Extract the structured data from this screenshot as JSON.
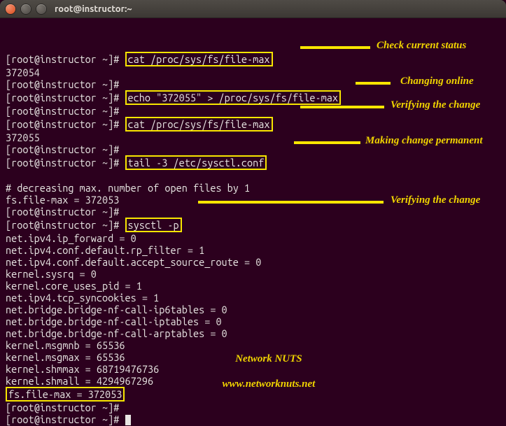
{
  "window": {
    "title": "root@instructor:~"
  },
  "prompt": "[root@instructor ~]# ",
  "cmds": {
    "cat1": "cat /proc/sys/fs/file-max",
    "echo": "echo \"372055\" > /proc/sys/fs/file-max",
    "cat2": "cat /proc/sys/fs/file-max",
    "tail": "tail -3 /etc/sysctl.conf",
    "sysctl": "sysctl -p"
  },
  "out": {
    "v1": "372054",
    "v2": "372055",
    "tail_comment": "# decreasing max. number of open files by 1",
    "tail_line": "fs.file-max = 372053",
    "sysctl_lines": [
      "net.ipv4.ip_forward = 0",
      "net.ipv4.conf.default.rp_filter = 1",
      "net.ipv4.conf.default.accept_source_route = 0",
      "kernel.sysrq = 0",
      "kernel.core_uses_pid = 1",
      "net.ipv4.tcp_syncookies = 1",
      "net.bridge.bridge-nf-call-ip6tables = 0",
      "net.bridge.bridge-nf-call-iptables = 0",
      "net.bridge.bridge-nf-call-arptables = 0",
      "kernel.msgmnb = 65536",
      "kernel.msgmax = 65536",
      "kernel.shmmax = 68719476736",
      "kernel.shmall = 4294967296"
    ],
    "final_hl": "fs.file-max = 372053"
  },
  "annotations": {
    "a1": "Check current status",
    "a2": "Changing online",
    "a3": "Verifying the change",
    "a4": "Making change permanent",
    "a5": "Verifying the change"
  },
  "watermark": {
    "l1": "Network NUTS",
    "l2": "www.networknuts.net"
  }
}
